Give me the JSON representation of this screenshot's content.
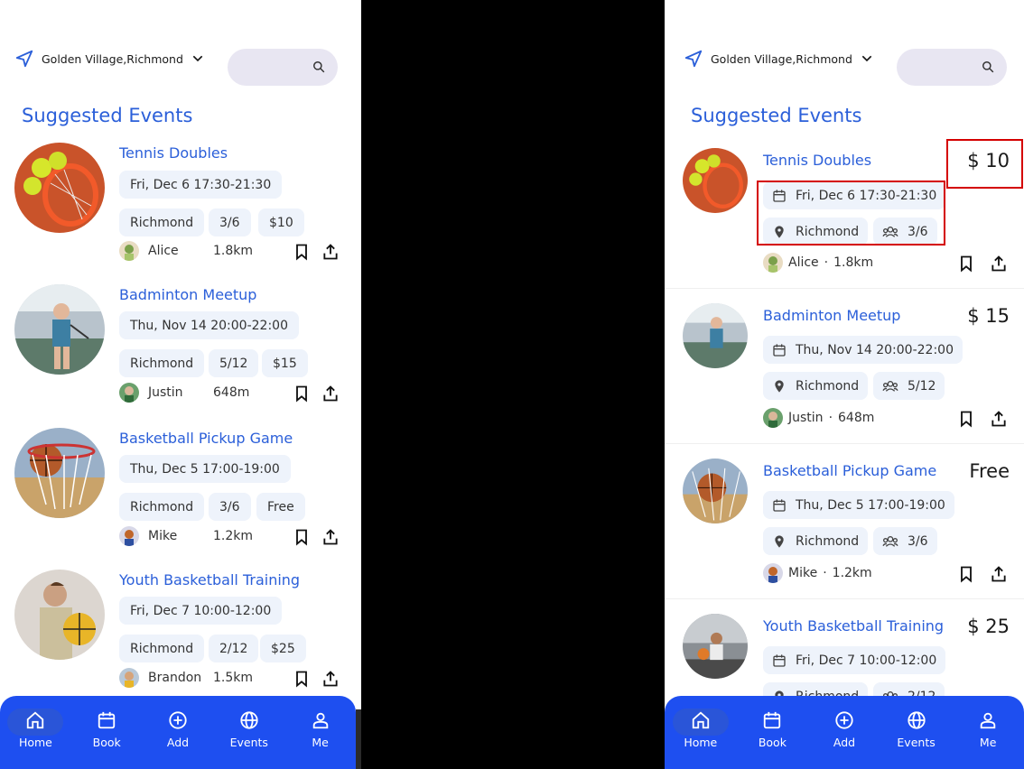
{
  "location": "Golden Village,Richmond",
  "section_title": "Suggested Events",
  "nav": [
    {
      "label": "Home",
      "icon": "home-icon"
    },
    {
      "label": "Book",
      "icon": "calendar-icon"
    },
    {
      "label": "Add",
      "icon": "add-circle-icon"
    },
    {
      "label": "Events",
      "icon": "globe-icon"
    },
    {
      "label": "Me",
      "icon": "person-icon"
    }
  ],
  "events": [
    {
      "title": "Tennis Doubles",
      "date": "Fri, Dec 6 17:30-21:30",
      "place": "Richmond",
      "slots": "3/6",
      "price": "$10",
      "price_right": "$ 10",
      "host": "Alice",
      "distance": "1.8km"
    },
    {
      "title": "Badminton Meetup",
      "date": "Thu, Nov 14 20:00-22:00",
      "place": "Richmond",
      "slots": "5/12",
      "price": "$15",
      "price_right": "$ 15",
      "host": "Justin",
      "distance": "648m"
    },
    {
      "title": "Basketball Pickup Game",
      "date": "Thu, Dec 5 17:00-19:00",
      "place": "Richmond",
      "slots": "3/6",
      "price": "Free",
      "price_right": "Free",
      "host": "Mike",
      "distance": "1.2km"
    },
    {
      "title": "Youth Basketball Training",
      "date": "Fri, Dec 7 10:00-12:00",
      "place": "Richmond",
      "slots": "2/12",
      "price": "$25",
      "price_right": "$ 25",
      "host": "Brandon",
      "distance": "1.5km"
    }
  ],
  "right_separator": "·",
  "colors": {
    "accent": "#2b5fd9",
    "nav": "#1e4ff0",
    "chip": "#eef3fb",
    "highlight": "#d40000"
  }
}
